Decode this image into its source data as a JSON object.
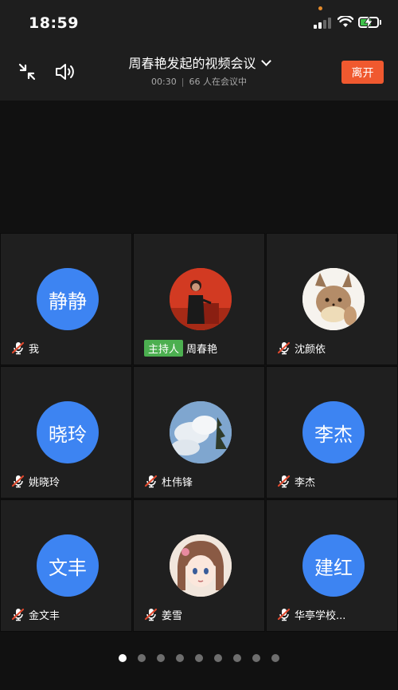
{
  "status_bar": {
    "time": "18:59"
  },
  "header": {
    "title": "周春艳发起的视频会议",
    "duration": "00:30",
    "separator": "|",
    "participant_count": "66 人在会议中",
    "leave_label": "离开"
  },
  "participants": [
    {
      "avatar_text": "静静",
      "name": "我",
      "muted": true
    },
    {
      "avatar_text": "",
      "name": "周春艳",
      "host_label": "主持人",
      "muted": false,
      "avatar_image": "speaker-photo"
    },
    {
      "avatar_text": "",
      "name": "沈颜依",
      "muted": true,
      "avatar_image": "cartoon-fox"
    },
    {
      "avatar_text": "晓玲",
      "name": "姚晓玲",
      "muted": true
    },
    {
      "avatar_text": "",
      "name": "杜伟锋",
      "muted": true,
      "avatar_image": "sky-clouds"
    },
    {
      "avatar_text": "李杰",
      "name": "李杰",
      "muted": true
    },
    {
      "avatar_text": "文丰",
      "name": "金文丰",
      "muted": true
    },
    {
      "avatar_text": "",
      "name": "姜雪",
      "muted": true,
      "avatar_image": "anime-girl"
    },
    {
      "avatar_text": "建红",
      "name": "华亭学校...",
      "muted": true
    }
  ],
  "pager": {
    "total": 9,
    "current": 1
  },
  "colors": {
    "accent_blue": "#3d84f2",
    "leave_red": "#f0592f",
    "host_green": "#4caf50",
    "mic_muted": "#e0492e"
  }
}
